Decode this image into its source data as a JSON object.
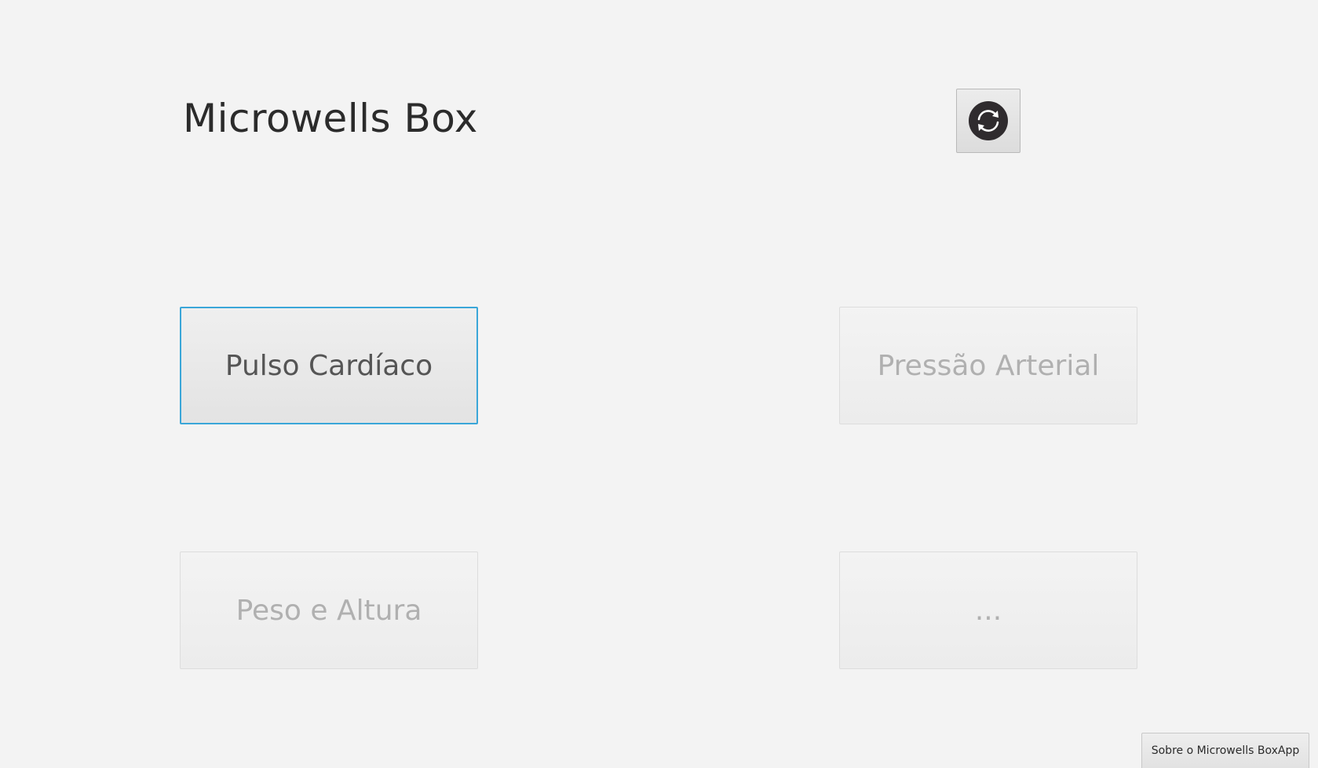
{
  "app": {
    "title": "Microwells Box"
  },
  "toolbar": {
    "refresh_icon": "refresh-icon"
  },
  "measurements": [
    {
      "label": "Pulso Cardíaco",
      "state": "active"
    },
    {
      "label": "Pressão Arterial",
      "state": "disabled"
    },
    {
      "label": "Peso e Altura",
      "state": "disabled"
    },
    {
      "label": "...",
      "state": "disabled"
    }
  ],
  "footer": {
    "about_label": "Sobre o Microwells BoxApp"
  },
  "colors": {
    "background": "#f3f3f3",
    "focus_border": "#3aa6d8",
    "disabled_text": "#b0b0b0",
    "icon_dark": "#2f2b2e"
  }
}
